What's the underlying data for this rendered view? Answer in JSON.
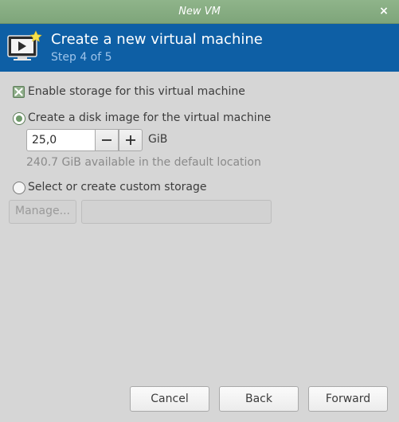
{
  "window": {
    "title": "New VM",
    "close_glyph": "×"
  },
  "header": {
    "title": "Create a new virtual machine",
    "step": "Step 4 of 5",
    "icon": "vm-monitor-icon",
    "bg_color": "#0e5fa5"
  },
  "storage": {
    "enable_label": "Enable storage for this virtual machine",
    "enable_checked": true,
    "option_disk_label": "Create a disk image for the virtual machine",
    "option_disk_selected": true,
    "disk_size_value": "25,0",
    "disk_size_unit": "GiB",
    "available_text": "240.7 GiB available in the default location",
    "option_custom_label": "Select or create custom storage",
    "option_custom_selected": false,
    "manage_label": "Manage...",
    "custom_path_value": ""
  },
  "footer": {
    "cancel_label": "Cancel",
    "back_label": "Back",
    "forward_label": "Forward"
  }
}
